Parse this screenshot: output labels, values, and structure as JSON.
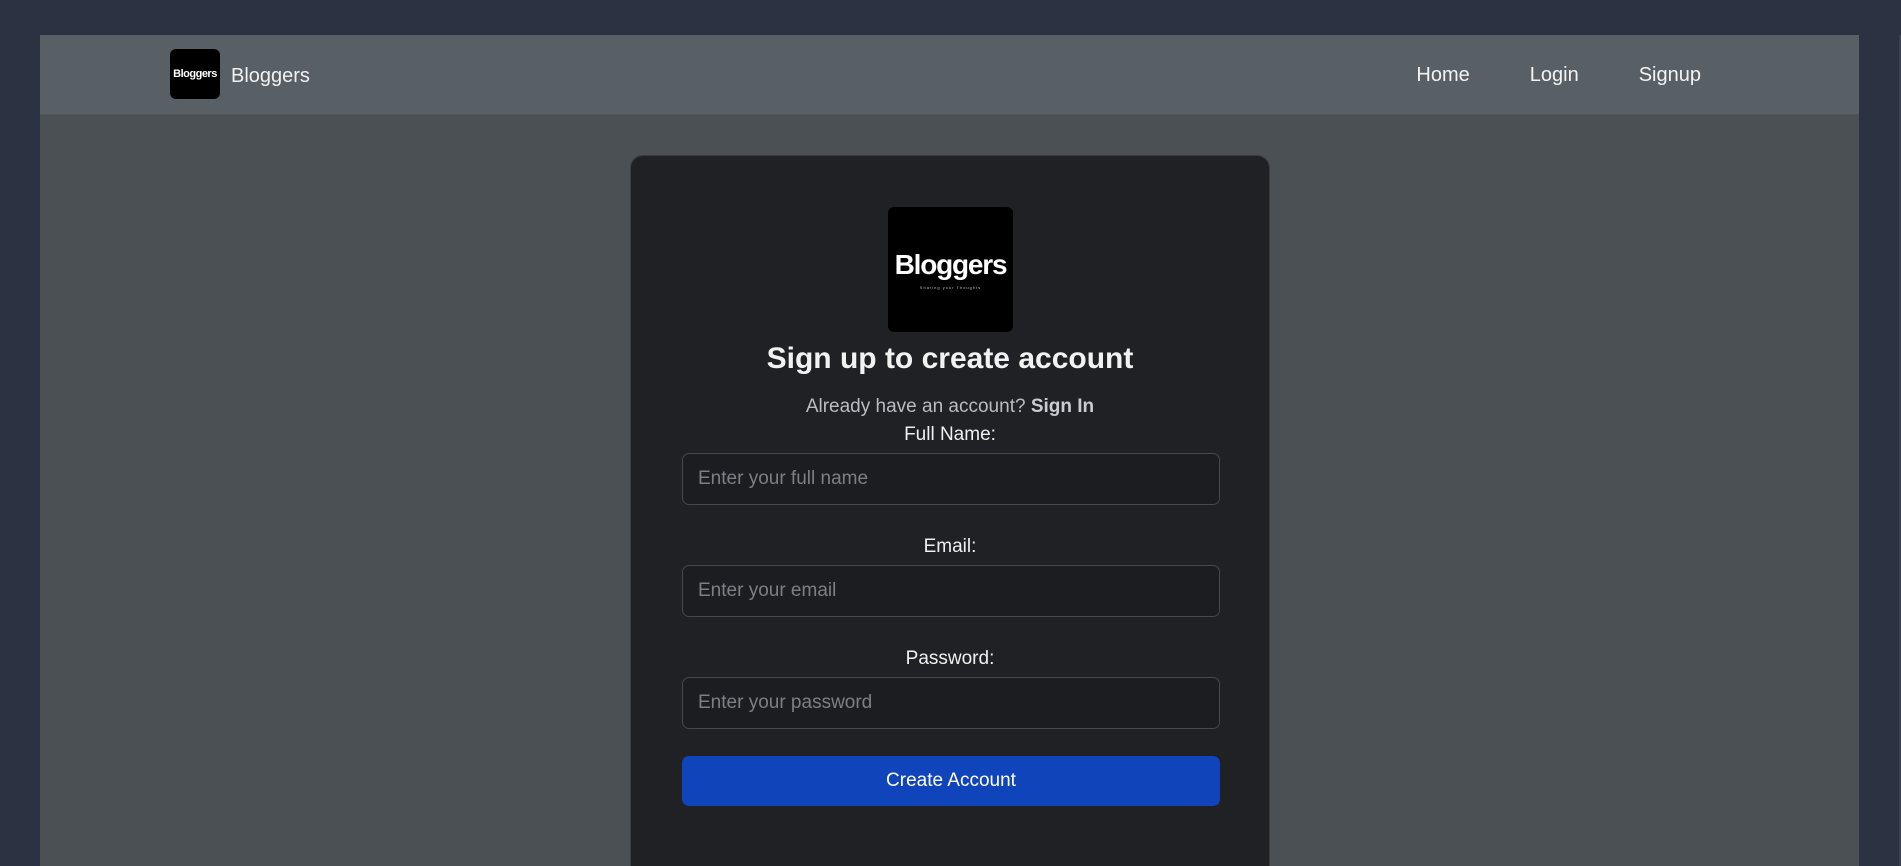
{
  "navbar": {
    "brand_logo_text": "Bloggers",
    "brand_name": "Bloggers",
    "links": [
      "Home",
      "Login",
      "Signup"
    ]
  },
  "card": {
    "logo_text": "Bloggers",
    "logo_tagline": "Sharing your Thoughts",
    "title": "Sign up to create account",
    "subtitle": "Already have an account?",
    "signin_link": "Sign In",
    "fields": {
      "full_name": {
        "label": "Full Name:",
        "placeholder": "Enter your full name",
        "value": ""
      },
      "email": {
        "label": "Email:",
        "placeholder": "Enter your email",
        "value": ""
      },
      "password": {
        "label": "Password:",
        "placeholder": "Enter your password",
        "value": ""
      }
    },
    "submit_label": "Create Account"
  },
  "colors": {
    "page_bg": "#2b3241",
    "content_bg": "#4b5055",
    "navbar_bg": "#596065",
    "card_bg": "#202124",
    "accent": "#0f44bb"
  }
}
